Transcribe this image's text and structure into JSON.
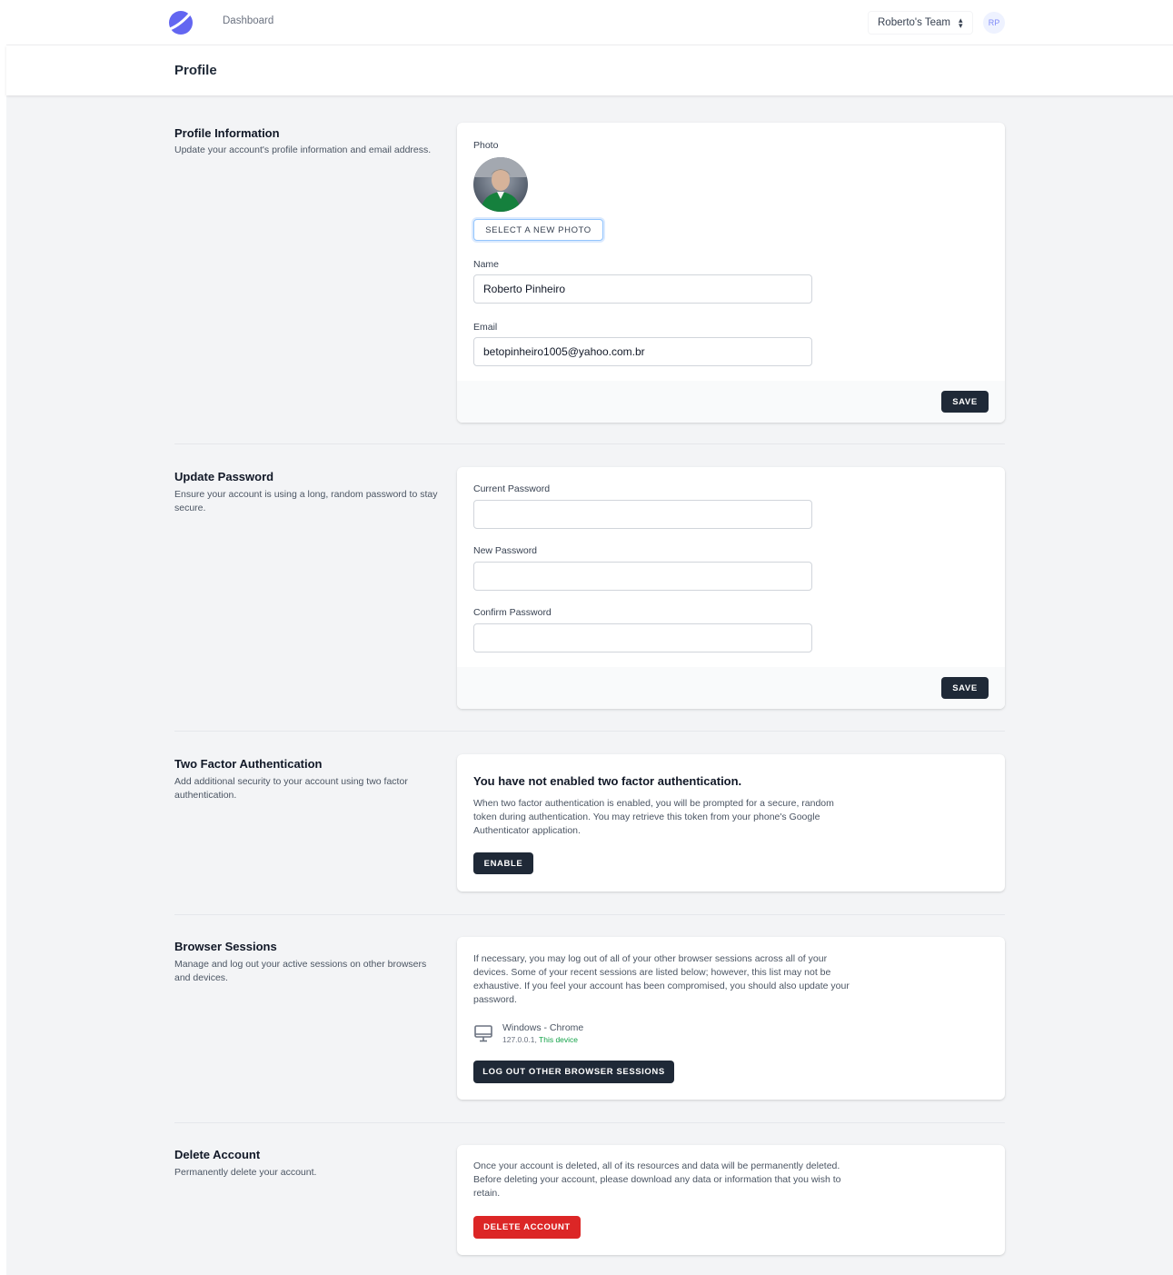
{
  "nav": {
    "dashboard_label": "Dashboard",
    "team_label": "Roberto's Team",
    "user_initials": "RP"
  },
  "header": {
    "title": "Profile"
  },
  "profile_info": {
    "title": "Profile Information",
    "description": "Update your account's profile information and email address.",
    "photo_label": "Photo",
    "select_photo_button": "SELECT A NEW PHOTO",
    "name_label": "Name",
    "name_value": "Roberto Pinheiro",
    "email_label": "Email",
    "email_value": "betopinheiro1005@yahoo.com.br",
    "save_button": "SAVE"
  },
  "update_password": {
    "title": "Update Password",
    "description": "Ensure your account is using a long, random password to stay secure.",
    "current_label": "Current Password",
    "new_label": "New Password",
    "confirm_label": "Confirm Password",
    "save_button": "SAVE"
  },
  "two_factor": {
    "title": "Two Factor Authentication",
    "description": "Add additional security to your account using two factor authentication.",
    "status": "You have not enabled two factor authentication.",
    "body": "When two factor authentication is enabled, you will be prompted for a secure, random token during authentication. You may retrieve this token from your phone's Google Authenticator application.",
    "enable_button": "ENABLE"
  },
  "browser_sessions": {
    "title": "Browser Sessions",
    "description": "Manage and log out your active sessions on other browsers and devices.",
    "body": "If necessary, you may log out of all of your other browser sessions across all of your devices. Some of your recent sessions are listed below; however, this list may not be exhaustive. If you feel your account has been compromised, you should also update your password.",
    "session": {
      "device": "Windows - Chrome",
      "ip": "127.0.0.1,",
      "current": "This device",
      "icon": "desktop-icon"
    },
    "logout_button": "LOG OUT OTHER BROWSER SESSIONS"
  },
  "delete_account": {
    "title": "Delete Account",
    "description": "Permanently delete your account.",
    "body": "Once your account is deleted, all of its resources and data will be permanently deleted. Before deleting your account, please download any data or information that you wish to retain.",
    "delete_button": "DELETE ACCOUNT"
  },
  "colors": {
    "accent": "#6366f1",
    "dark_button": "#1f2937",
    "danger": "#dc2626",
    "success": "#16a34a",
    "background": "#f3f4f6"
  }
}
